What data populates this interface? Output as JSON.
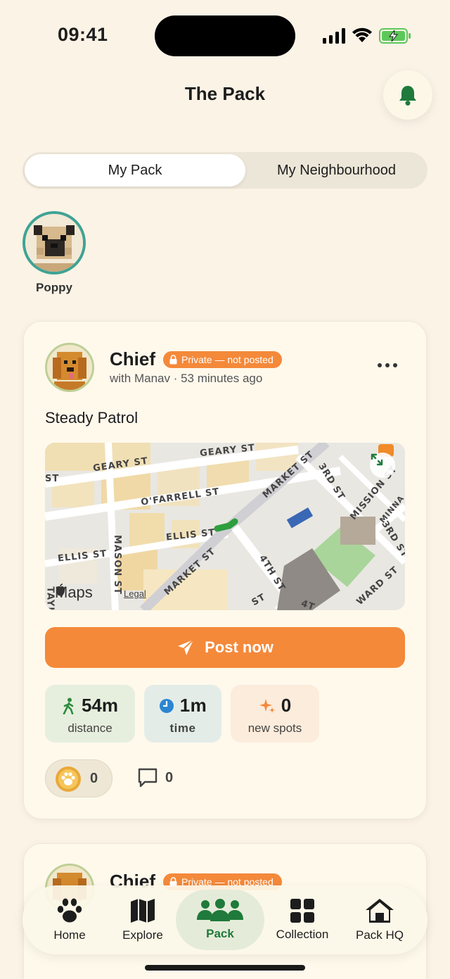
{
  "status": {
    "time": "09:41"
  },
  "header": {
    "title": "The Pack"
  },
  "segments": {
    "active": "My Pack",
    "inactive": "My Neighbourhood"
  },
  "pets": [
    {
      "name": "Poppy"
    }
  ],
  "post": {
    "dog_name": "Chief",
    "badge": "Private — not posted",
    "subline": "with Manav · 53 minutes ago",
    "title": "Steady Patrol",
    "map": {
      "streets": [
        "GEARY ST",
        "GEARY ST",
        "ST",
        "O'FARRELL ST",
        "MARKET ST",
        "3RD ST",
        "MISSION ST",
        "MINNA",
        "3RD ST",
        "ELLIS ST",
        "ELLIS ST",
        "MASON ST",
        "MARKET ST",
        "4TH ST",
        "WARD ST",
        "ST",
        "4T",
        "TAYL"
      ],
      "maps_label": "Maps",
      "legal": "Legal"
    },
    "post_button": "Post now",
    "stats": [
      {
        "value": "54m",
        "label": "distance",
        "color": "#2e8b3e"
      },
      {
        "value": "1m",
        "label": "time",
        "color": "#2b86d1"
      },
      {
        "value": "0",
        "label": "new spots",
        "color": "#f4893a"
      }
    ],
    "coins": "0",
    "comments": "0"
  },
  "second_post": {
    "dog_name": "Chief",
    "badge": "Private — not posted"
  },
  "tabbar": {
    "items": [
      {
        "label": "Home",
        "icon": "paw-icon"
      },
      {
        "label": "Explore",
        "icon": "map-icon"
      },
      {
        "label": "Pack",
        "icon": "people-icon"
      },
      {
        "label": "Collection",
        "icon": "grid-icon"
      },
      {
        "label": "Pack HQ",
        "icon": "house-icon"
      }
    ]
  }
}
